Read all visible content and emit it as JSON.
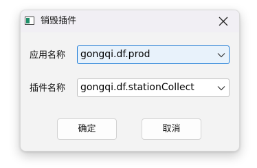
{
  "window": {
    "title": "销毁插件",
    "icon": "window-app-icon",
    "close_icon": "close-icon"
  },
  "form": {
    "app_name_label": "应用名称",
    "app_name_value": "gongqi.df.prod",
    "plugin_name_label": "插件名称",
    "plugin_name_value": "gongqi.df.stationCollect"
  },
  "buttons": {
    "ok": "确定",
    "cancel": "取消"
  },
  "colors": {
    "focus_border": "#1e7bd6",
    "focus_fill": "#e8f2fb",
    "dialog_bg": "#f3f3f3",
    "titlebar_bg": "#f1eff4"
  }
}
